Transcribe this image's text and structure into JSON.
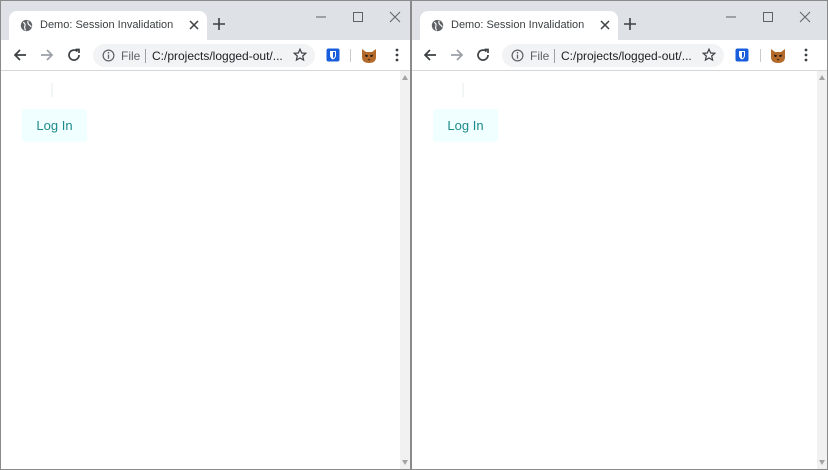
{
  "windows": [
    {
      "tab_title": "Demo: Session Invalidation",
      "scheme_label": "File",
      "url": "C:/projects/logged-out/...",
      "login_label": "Log In"
    },
    {
      "tab_title": "Demo: Session Invalidation",
      "scheme_label": "File",
      "url": "C:/projects/logged-out/...",
      "login_label": "Log In"
    }
  ],
  "colors": {
    "tabstrip": "#dee1e6",
    "omnibox": "#f1f3f4",
    "login_bg": "#f0ffff",
    "login_text": "#1e8a8a",
    "bitwarden": "#175ddc"
  },
  "icons": [
    "globe-icon",
    "close-icon",
    "plus-icon",
    "minimize-icon",
    "maximize-icon",
    "window-close-icon",
    "back-arrow-icon",
    "forward-arrow-icon",
    "reload-icon",
    "info-icon",
    "star-icon",
    "bitwarden-shield-icon",
    "cat-avatar-icon",
    "kebab-menu-icon"
  ]
}
